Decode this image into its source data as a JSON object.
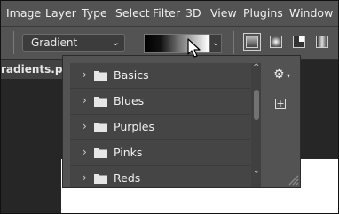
{
  "menu": {
    "items": [
      "Image",
      "Layer",
      "Type",
      "Select",
      "Filter",
      "3D",
      "View",
      "Plugins",
      "Window"
    ]
  },
  "options": {
    "mode_value": "Gradient",
    "gradient_types": [
      "linear-gradient-icon",
      "radial-gradient-icon",
      "angle-gradient-icon",
      "reflected-gradient-icon"
    ]
  },
  "document": {
    "tab_title": "radients.psd"
  },
  "gradient_picker": {
    "groups": [
      {
        "label": "Basics"
      },
      {
        "label": "Blues"
      },
      {
        "label": "Purples"
      },
      {
        "label": "Pinks"
      },
      {
        "label": "Reds"
      }
    ],
    "scroll_position": 0.15
  },
  "colors": {
    "ui_dark": "#535353",
    "panel_bg": "#454545",
    "folder": "#e6e6e6"
  }
}
